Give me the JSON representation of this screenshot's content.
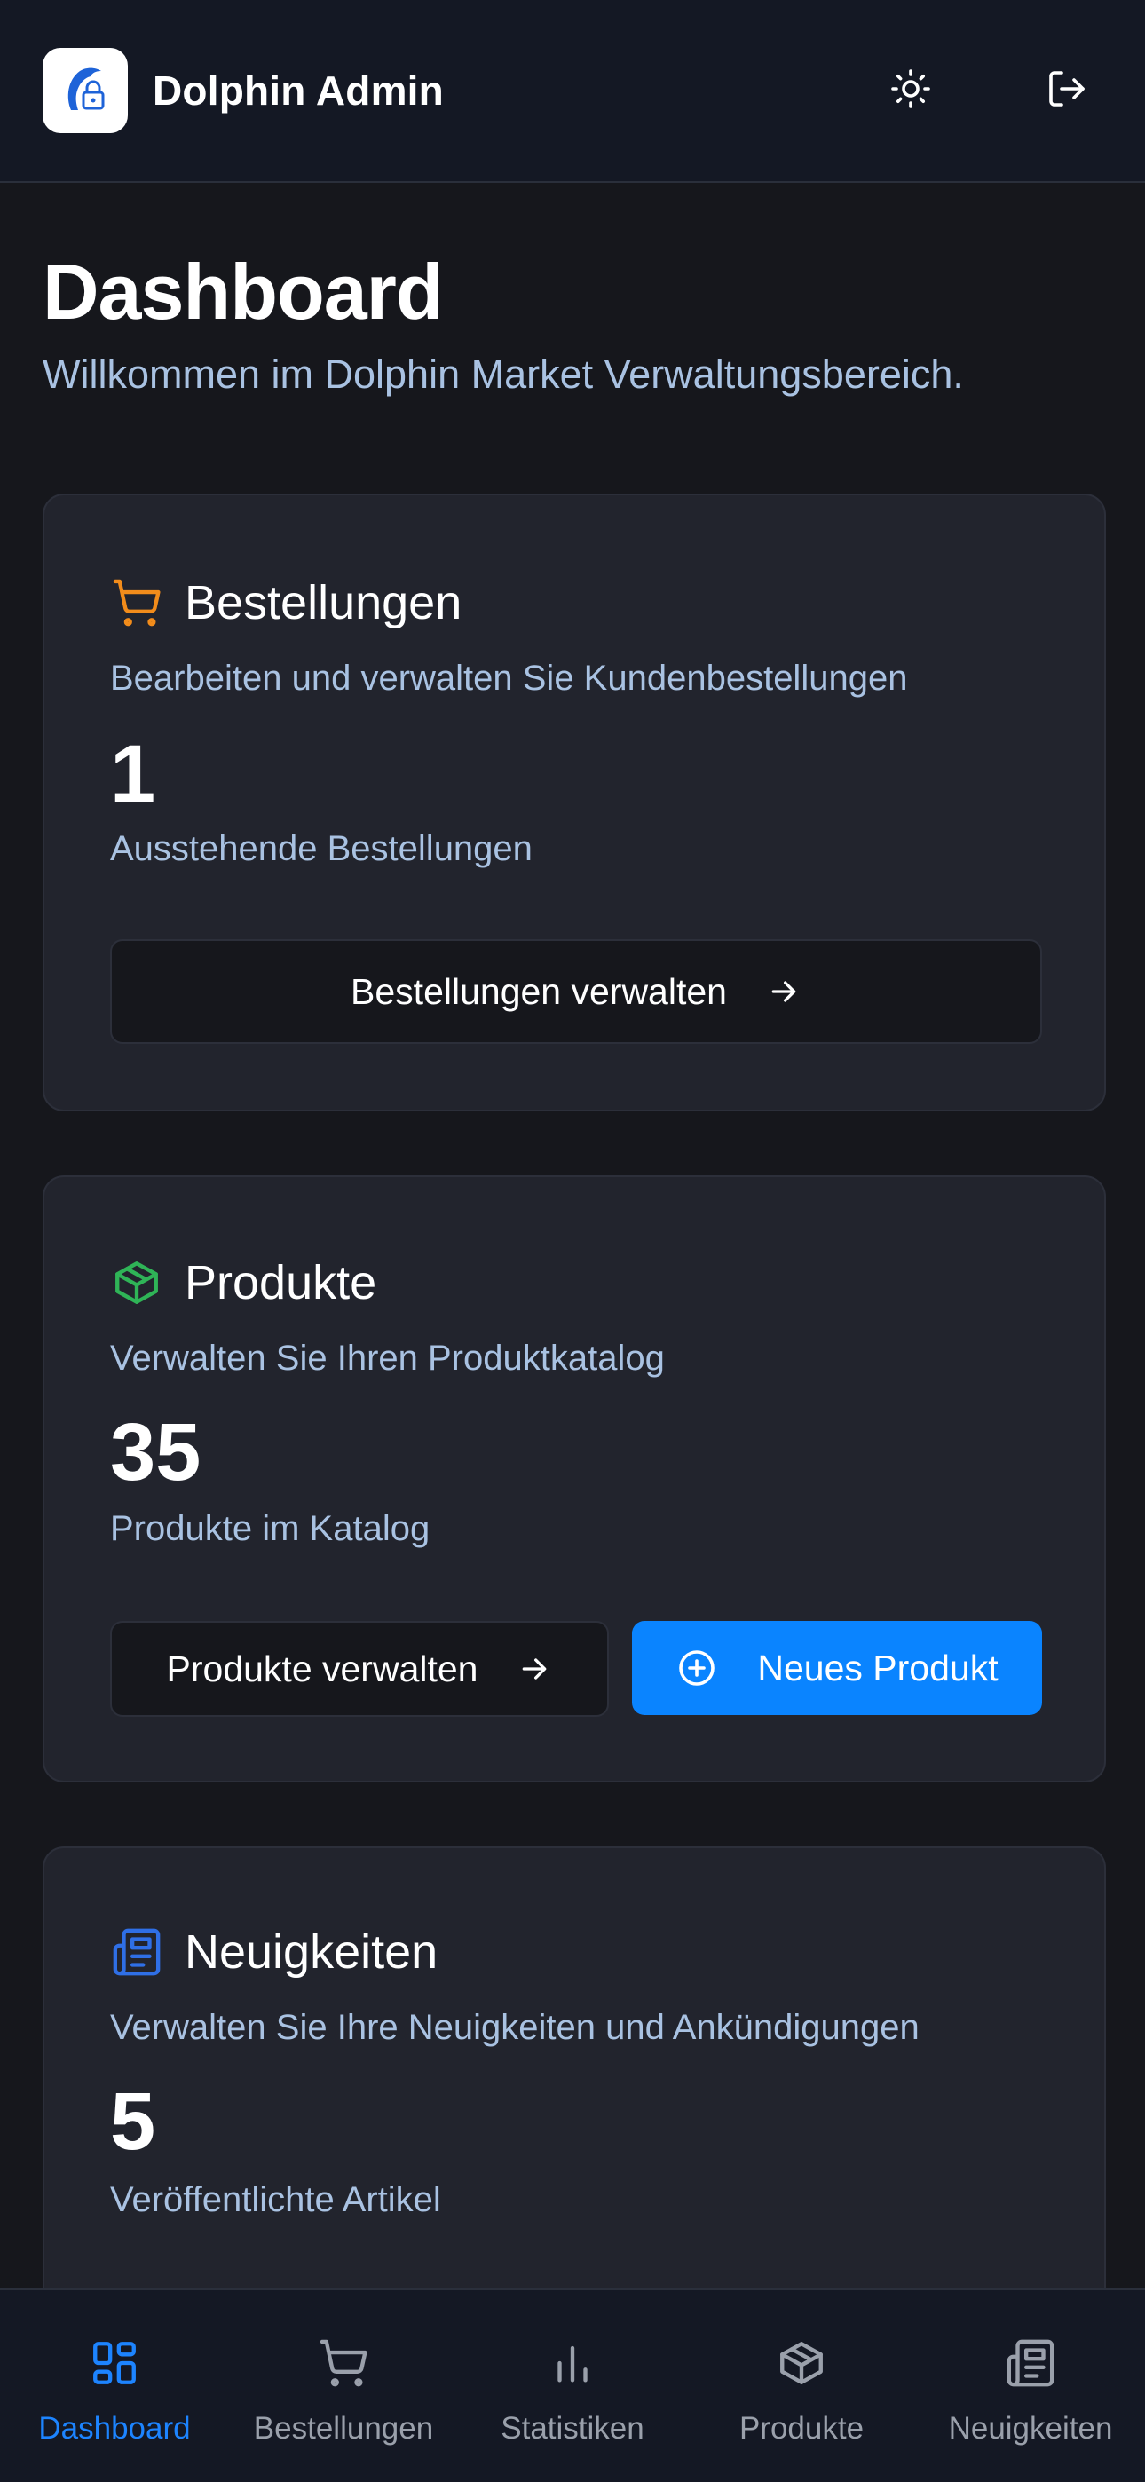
{
  "header": {
    "app_title": "Dolphin Admin",
    "logo_icon": "dolphin-lock-logo",
    "theme_icon": "sun-icon",
    "logout_icon": "logout-icon"
  },
  "page": {
    "title": "Dashboard",
    "subtitle": "Willkommen im Dolphin Market Verwaltungsbereich."
  },
  "cards": {
    "orders": {
      "icon": "cart-icon",
      "icon_color": "#f28c1b",
      "title": "Bestellungen",
      "description": "Bearbeiten und verwalten Sie Kundenbestellungen",
      "count": "1",
      "count_label": "Ausstehende Bestellungen",
      "button_label": "Bestellungen verwalten"
    },
    "products": {
      "icon": "package-icon",
      "icon_color": "#2fb457",
      "title": "Produkte",
      "description": "Verwalten Sie Ihren Produktkatalog",
      "count": "35",
      "count_label": "Produkte im Katalog",
      "button_label": "Produkte verwalten",
      "new_button_label": "Neues Produkt"
    },
    "news": {
      "icon": "newspaper-icon",
      "icon_color": "#2f6fe6",
      "title": "Neuigkeiten",
      "description": "Verwalten Sie Ihre Neuigkeiten und Ankündigungen",
      "count": "5",
      "count_label": "Veröffentlichte Artikel"
    }
  },
  "bottom_nav": {
    "items": [
      {
        "label": "Dashboard",
        "icon": "dashboard-icon",
        "active": true
      },
      {
        "label": "Bestellungen",
        "icon": "cart-icon",
        "active": false
      },
      {
        "label": "Statistiken",
        "icon": "bar-chart-icon",
        "active": false
      },
      {
        "label": "Produkte",
        "icon": "package-icon",
        "active": false
      },
      {
        "label": "Neuigkeiten",
        "icon": "newspaper-icon",
        "active": false
      }
    ]
  },
  "colors": {
    "accent": "#0a84ff",
    "nav_active": "#1d84ff",
    "muted_text": "#a9c2e2"
  }
}
